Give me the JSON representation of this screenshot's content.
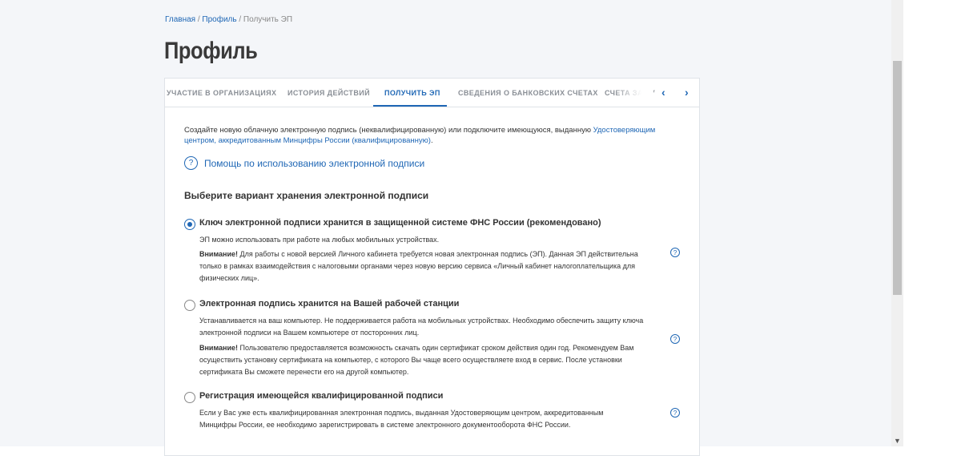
{
  "breadcrumb": {
    "home": "Главная",
    "sep": " / ",
    "profile": "Профиль",
    "current": "Получить ЭП"
  },
  "page_title": "Профиль",
  "tabs": [
    {
      "label": "Участие в организациях"
    },
    {
      "label": "История действий"
    },
    {
      "label": "Получить ЭП"
    },
    {
      "label": "Сведения о банковских счетах"
    },
    {
      "label": "Счета за ру"
    }
  ],
  "intro": {
    "text": "Создайте новую облачную электронную подпись (неквалифицированную) или подключите имеющуюся, выданную ",
    "link": "Удостоверяющим центром, аккредитованным Минцифры России (квалифицированную)",
    "end": "."
  },
  "help_link": "Помощь по использованию электронной подписи",
  "section_title": "Выберите вариант хранения электронной подписи",
  "options": [
    {
      "title": "Ключ электронной подписи хранится в защищенной системе ФНС России (рекомендовано)",
      "desc": "ЭП можно использовать при работе на любых мобильных устройствах.",
      "warn_label": "Внимание!",
      "warn": " Для работы с новой версией Личного кабинета требуется новая электронная подпись (ЭП). Данная ЭП  действительна только в рамках взаимодействия с налоговыми органами через новую версию сервиса  «Личный кабинет налогоплательщика для физических лиц».",
      "checked": true
    },
    {
      "title": "Электронная подпись хранится на Вашей рабочей станции",
      "desc": "Устанавливается на ваш компьютер. Не поддерживается работа на мобильных устройствах. Необходимо обеспечить  защиту ключа электронной подписи на Вашем компьютере от посторонних лиц.",
      "warn_label": "Внимание!",
      "warn": " Пользователю предоставляется возможность скачать один сертификат  сроком действия один год. Рекомендуем Вам осуществить установку сертификата на компьютер, с которого Вы  чаще всего осуществляете вход в сервис. После установки сертификата Вы сможете перенести его на другой  компьютер.",
      "checked": false
    },
    {
      "title": "Регистрация имеющейся квалифицированной подписи",
      "desc": "Если у Вас уже есть квалифицированная электронная подпись, выданная Удостоверяющим центром, аккредитованным Минцифры России, ее необходимо зарегистрировать в системе электронного документооборота ФНС России.",
      "checked": false
    }
  ],
  "icons": {
    "help": "?",
    "tab_prev": "‹",
    "tab_next": "›",
    "scroll_down": "▼"
  },
  "colors": {
    "accent": "#1f67b5",
    "page_bg": "#f4f6f9"
  }
}
